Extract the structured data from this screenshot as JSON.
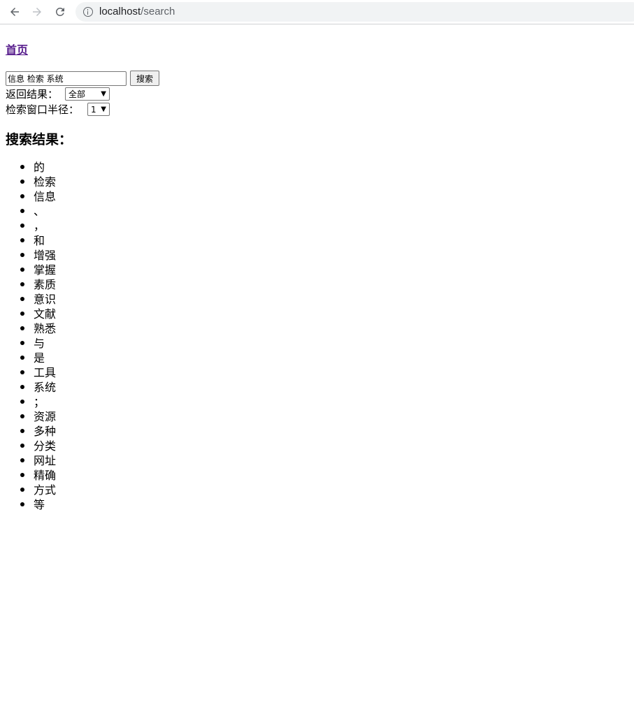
{
  "browser": {
    "url_host": "localhost",
    "url_path": "/search"
  },
  "page": {
    "home_link": "首页",
    "search": {
      "value": "信息 检索 系统",
      "button_label": "搜索"
    },
    "return_results": {
      "label": "返回结果：",
      "selected": "全部"
    },
    "window_radius": {
      "label": "检索窗口半径：",
      "selected": "1"
    },
    "results_heading": "搜索结果：",
    "results": [
      "的",
      "检索",
      "信息",
      "、",
      "，",
      "和",
      "增强",
      "掌握",
      "素质",
      "意识",
      "文献",
      "熟悉",
      "与",
      "是",
      "工具",
      "系统",
      "；",
      "资源",
      "多种",
      "分类",
      "网址",
      "精确",
      "方式",
      "等"
    ]
  },
  "colors": {
    "visited_link": "#551a8b",
    "omnibox_bg": "#f1f3f4"
  }
}
